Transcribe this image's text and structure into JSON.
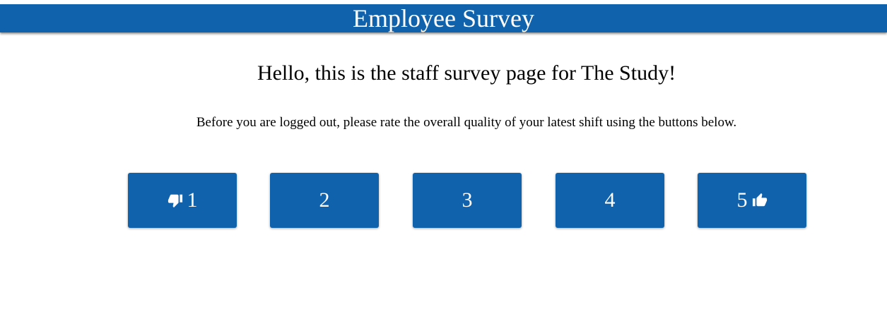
{
  "header": {
    "title": "Employee Survey"
  },
  "main": {
    "greeting": "Hello, this is the staff survey page for The Study!",
    "instructions": "Before you are logged out, please rate the overall quality of your latest shift using the buttons below."
  },
  "rating": {
    "buttons": [
      {
        "label": "1",
        "icon": "thumbs-down-icon"
      },
      {
        "label": "2"
      },
      {
        "label": "3"
      },
      {
        "label": "4"
      },
      {
        "label": "5",
        "icon": "thumbs-up-icon"
      }
    ]
  },
  "colors": {
    "brand": "#1162ad",
    "text_on_brand": "#ffffff"
  }
}
